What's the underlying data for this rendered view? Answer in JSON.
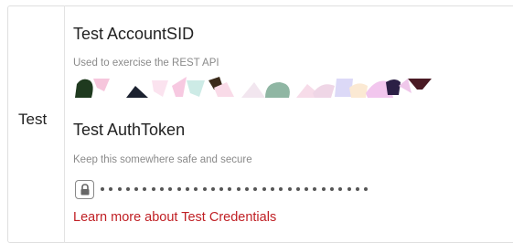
{
  "row_label": "Test",
  "account_sid": {
    "heading": "Test AccountSID",
    "help": "Used to exercise the REST API"
  },
  "auth_token": {
    "heading": "Test AuthToken",
    "help": "Keep this somewhere safe and secure",
    "lock_icon": "lock-icon",
    "masked_dot_count": 32
  },
  "learn_more_link": "Learn more about Test Credentials",
  "colors": {
    "link": "#c02025",
    "border": "#dfdfdf",
    "help_text": "#8a8a8a"
  }
}
